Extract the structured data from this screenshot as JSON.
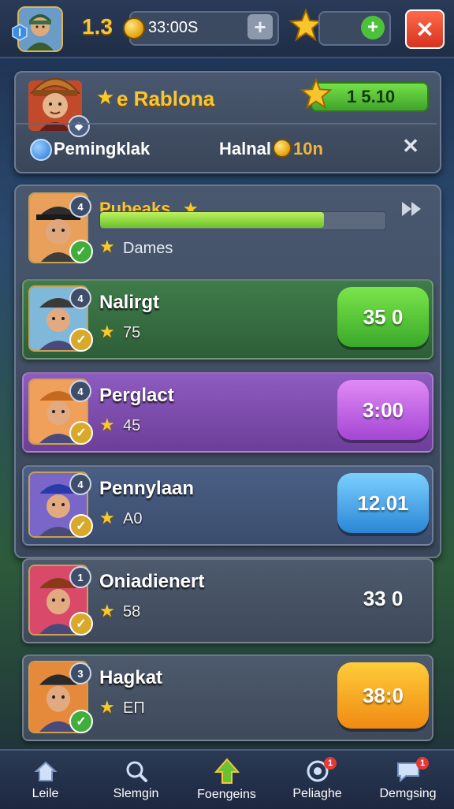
{
  "topbar": {
    "level": "1.3",
    "coins": "33:00S",
    "close_label": "✕"
  },
  "player_card": {
    "title": "e Rablona",
    "xp_value": "1 5.10",
    "subtitle_left": "Pemingklak",
    "subtitle_right_prefix": "Halnal",
    "subtitle_right_value": "10n",
    "close_label": "✕"
  },
  "progress_card": {
    "name": "Pubeaks",
    "label": "Dames",
    "progress": 0.79
  },
  "rows": [
    {
      "name": "Nalirgt",
      "rating": "75",
      "action": "35 0",
      "variant": "green",
      "rank": "4"
    },
    {
      "name": "Perglact",
      "rating": "45",
      "action": "3:00",
      "variant": "purple",
      "rank": "4"
    },
    {
      "name": "Pennylaan",
      "rating": "A0",
      "action": "12.01",
      "variant": "blue",
      "rank": "4"
    },
    {
      "name": "Oniadienert",
      "rating": "58",
      "action": "33 0",
      "variant": "grey",
      "rank": "1"
    },
    {
      "name": "Hagkat",
      "rating": "ЕП",
      "action": "38:0",
      "variant": "orange",
      "rank": "3"
    }
  ],
  "nav": [
    {
      "label": "Leile",
      "icon": "home-icon",
      "badge": ""
    },
    {
      "label": "Slemgin",
      "icon": "search-icon",
      "badge": ""
    },
    {
      "label": "Foengeins",
      "icon": "upgrade-icon",
      "badge": ""
    },
    {
      "label": "Peliaghe",
      "icon": "target-icon",
      "badge": "1"
    },
    {
      "label": "Demgsing",
      "icon": "chat-icon",
      "badge": "1"
    }
  ],
  "colors": {
    "green_button": "#4cc23b",
    "purple_button": "#c35ee8",
    "blue_button": "#3fa6e8",
    "orange_button": "#f5a318",
    "gold": "#f6c63a"
  }
}
